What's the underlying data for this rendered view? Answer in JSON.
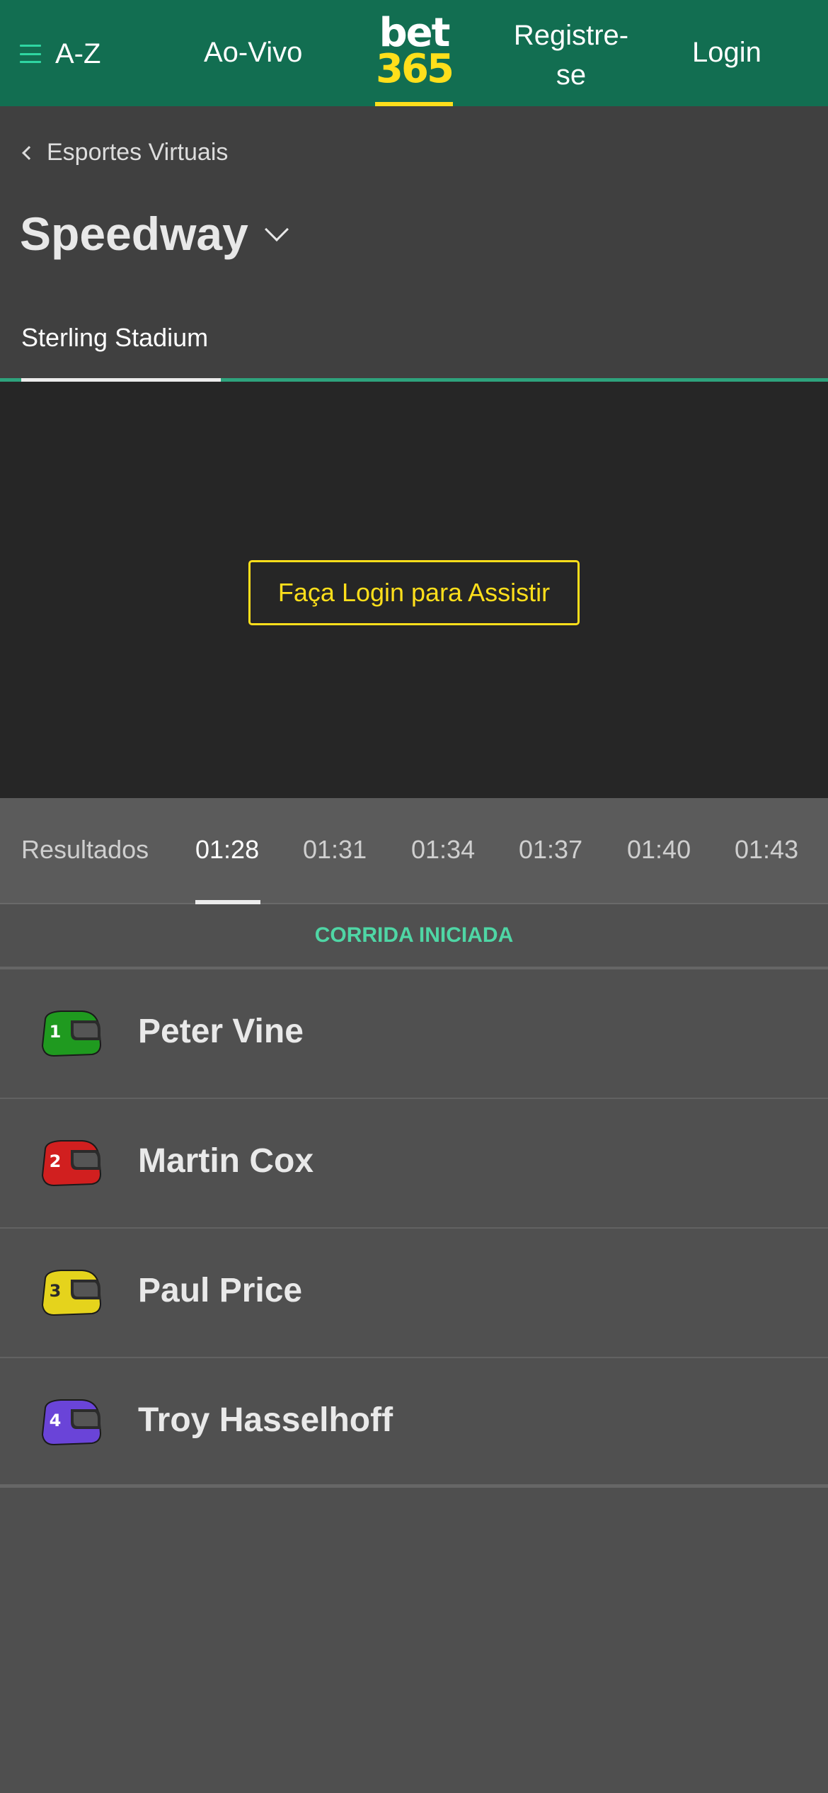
{
  "header": {
    "az_label": "A-Z",
    "live_label": "Ao-Vivo",
    "logo_top": "bet",
    "logo_bottom": "365",
    "register_label": "Registre-se",
    "login_label": "Login",
    "brand_green": "#126e51",
    "brand_yellow": "#ffdf1b"
  },
  "breadcrumb": {
    "label": "Esportes Virtuais"
  },
  "page": {
    "title": "Speedway",
    "venue_tab": "Sterling Stadium"
  },
  "video": {
    "watch_button": "Faça Login para Assistir"
  },
  "time_tabs": [
    {
      "label": "Resultados",
      "active": false
    },
    {
      "label": "01:28",
      "active": true
    },
    {
      "label": "01:31",
      "active": false
    },
    {
      "label": "01:34",
      "active": false
    },
    {
      "label": "01:37",
      "active": false
    },
    {
      "label": "01:40",
      "active": false
    },
    {
      "label": "01:43",
      "active": false
    }
  ],
  "status": {
    "label": "CORRIDA INICIADA",
    "color": "#4fd6a5"
  },
  "runners": [
    {
      "number": "1",
      "name": "Peter Vine",
      "helmet_color": "#1f9a1f",
      "helmet_dark": "#0d5f0d"
    },
    {
      "number": "2",
      "name": "Martin Cox",
      "helmet_color": "#d11f1f",
      "helmet_dark": "#7d0d0d"
    },
    {
      "number": "3",
      "name": "Paul Price",
      "helmet_color": "#e5d31c",
      "helmet_dark": "#8f8208"
    },
    {
      "number": "4",
      "name": "Troy Hasselhoff",
      "helmet_color": "#6a44d8",
      "helmet_dark": "#36208a"
    }
  ]
}
